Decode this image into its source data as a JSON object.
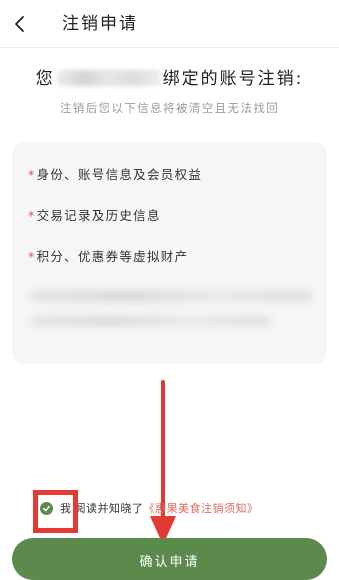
{
  "header": {
    "title": "注销申请",
    "back_icon": "chevron-left-icon"
  },
  "account": {
    "heading_prefix": "您",
    "heading_suffix": "绑定的账号注销:",
    "subtitle": "注销后您以下信息将被清空且无法找回"
  },
  "info_items": [
    {
      "star": "*",
      "label": "身份、账号信息及会员权益"
    },
    {
      "star": "*",
      "label": "交易记录及历史信息"
    },
    {
      "star": "*",
      "label": "积分、优惠券等虚拟财产"
    }
  ],
  "agreement": {
    "checked": true,
    "check_icon": "check-circle-icon",
    "prefix": "我",
    "text": "阅读并知晓了",
    "link": "《惠果美食注销须知》"
  },
  "confirm": {
    "label": "确认申请"
  },
  "colors": {
    "brand_green": "#5b8a4c",
    "link_red": "#e0675f",
    "annotation_red": "#e23a32",
    "required_star": "#e0524e"
  }
}
